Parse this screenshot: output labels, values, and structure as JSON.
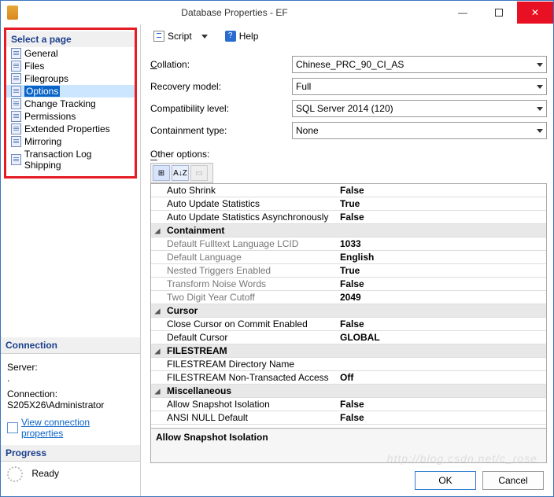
{
  "window": {
    "title": "Database Properties - EF",
    "minimize": "—",
    "close": "✕"
  },
  "sidebar": {
    "header": "Select a page",
    "items": [
      {
        "label": "General"
      },
      {
        "label": "Files"
      },
      {
        "label": "Filegroups"
      },
      {
        "label": "Options",
        "selected": true
      },
      {
        "label": "Change Tracking"
      },
      {
        "label": "Permissions"
      },
      {
        "label": "Extended Properties"
      },
      {
        "label": "Mirroring"
      },
      {
        "label": "Transaction Log Shipping"
      }
    ]
  },
  "connection": {
    "header": "Connection",
    "server_label": "Server:",
    "server_value": ".",
    "conn_label": "Connection:",
    "conn_value": "S205X26\\Administrator",
    "link": "View connection properties"
  },
  "progress": {
    "header": "Progress",
    "status": "Ready"
  },
  "toolbar": {
    "script": "Script",
    "help": "Help"
  },
  "form": {
    "collation_label": "Collation:",
    "collation_value": "Chinese_PRC_90_CI_AS",
    "recovery_label": "Recovery model:",
    "recovery_value": "Full",
    "compat_label": "Compatibility level:",
    "compat_value": "SQL Server 2014 (120)",
    "containment_label": "Containment type:",
    "containment_value": "None",
    "other_label": "Other options:"
  },
  "grid_toolbar": {
    "sort_az": "A↓Z"
  },
  "grid": [
    {
      "type": "prop",
      "name": "Auto Shrink",
      "value": "False",
      "bold": true
    },
    {
      "type": "prop",
      "name": "Auto Update Statistics",
      "value": "True",
      "bold": true
    },
    {
      "type": "prop",
      "name": "Auto Update Statistics Asynchronously",
      "value": "False",
      "bold": true
    },
    {
      "type": "cat",
      "name": "Containment"
    },
    {
      "type": "prop",
      "name": "Default Fulltext Language LCID",
      "value": "1033",
      "readonly": true,
      "bold": true
    },
    {
      "type": "prop",
      "name": "Default Language",
      "value": "English",
      "readonly": true,
      "bold": true
    },
    {
      "type": "prop",
      "name": "Nested Triggers Enabled",
      "value": "True",
      "readonly": true,
      "bold": true
    },
    {
      "type": "prop",
      "name": "Transform Noise Words",
      "value": "False",
      "readonly": true,
      "bold": true
    },
    {
      "type": "prop",
      "name": "Two Digit Year Cutoff",
      "value": "2049",
      "readonly": true,
      "bold": true
    },
    {
      "type": "cat",
      "name": "Cursor"
    },
    {
      "type": "prop",
      "name": "Close Cursor on Commit Enabled",
      "value": "False",
      "bold": true
    },
    {
      "type": "prop",
      "name": "Default Cursor",
      "value": "GLOBAL",
      "bold": true
    },
    {
      "type": "cat",
      "name": "FILESTREAM"
    },
    {
      "type": "prop",
      "name": "FILESTREAM Directory Name",
      "value": ""
    },
    {
      "type": "prop",
      "name": "FILESTREAM Non-Transacted Access",
      "value": "Off",
      "bold": true
    },
    {
      "type": "cat",
      "name": "Miscellaneous"
    },
    {
      "type": "prop",
      "name": "Allow Snapshot Isolation",
      "value": "False",
      "bold": true
    },
    {
      "type": "prop",
      "name": "ANSI NULL Default",
      "value": "False",
      "bold": true
    }
  ],
  "description": {
    "title": "Allow Snapshot Isolation"
  },
  "buttons": {
    "ok": "OK",
    "cancel": "Cancel"
  },
  "watermark": "http://blog.csdn.net/c_rose"
}
